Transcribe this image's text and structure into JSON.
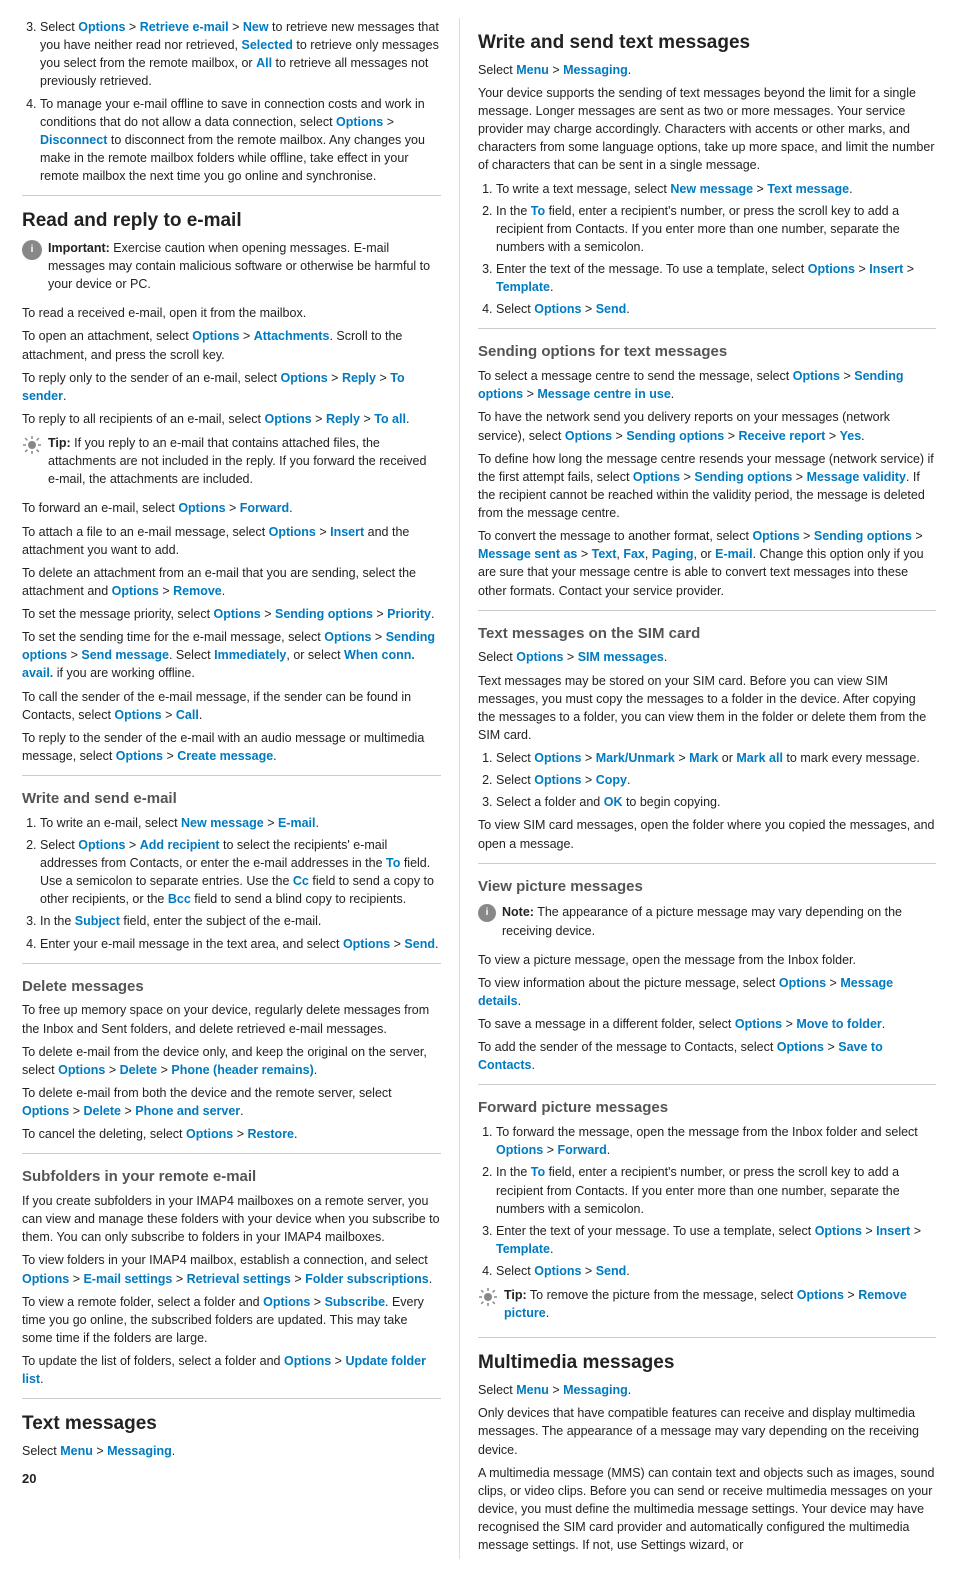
{
  "page_number": "20",
  "left": {
    "list_items_top": [
      {
        "num": "3.",
        "text": "Select ",
        "links": [
          {
            "label": "Options",
            "after": " > "
          },
          {
            "label": "Retrieve e-mail",
            "after": " > "
          },
          {
            "label": "New",
            "after": " to retrieve new messages that you have neither read nor retrieved, "
          },
          {
            "label": "Selected",
            "after": " to retrieve only messages you select from the remote mailbox, or "
          },
          {
            "label": "All",
            "after": " to retrieve all messages not previously retrieved."
          }
        ]
      },
      {
        "num": "4.",
        "text": "To manage your e-mail offline to save in connection costs and work in conditions that do not allow a data connection, select ",
        "links": [
          {
            "label": "Options",
            "after": " > "
          },
          {
            "label": "Disconnect",
            "after": " to disconnect from the remote mailbox. Any changes you make in the remote mailbox folders while offline, take effect in your remote mailbox the next time you go online and synchronise."
          }
        ]
      }
    ],
    "read_reply": {
      "heading": "Read and reply to e-mail",
      "important_label": "Important:",
      "important_text": " Exercise caution when opening messages. E-mail messages may contain malicious software or otherwise be harmful to your device or PC.",
      "para1": "To read a received e-mail, open it from the mailbox.",
      "para2_before": "To open an attachment, select ",
      "para2_link1": "Options",
      "para2_mid": " > ",
      "para2_link2": "Attachments",
      "para2_after": ". Scroll to the attachment, and press the scroll key.",
      "para3_before": "To reply only to the sender of an e-mail, select ",
      "para3_link1": "Options",
      "para3_mid": " > ",
      "para3_link2": "Reply",
      "para3_mid2": " > ",
      "para3_link3": "To sender",
      "para3_after": ".",
      "para4_before": "To reply to all recipients of an e-mail, select ",
      "para4_link1": "Options",
      "para4_mid": " > ",
      "para4_link2": "Reply",
      "para4_mid2": " > ",
      "para4_link3": "To all",
      "para4_after": ".",
      "tip1_label": "Tip:",
      "tip1_text": " If you reply to an e-mail that contains attached files, the attachments are not included in the reply. If you forward the received e-mail, the attachments are included.",
      "para5_before": "To forward an e-mail, select ",
      "para5_link1": "Options",
      "para5_mid": " > ",
      "para5_link2": "Forward",
      "para5_after": ".",
      "para6_before": "To attach a file to an e-mail message, select ",
      "para6_link1": "Options",
      "para6_mid": " > ",
      "para6_link2": "Insert",
      "para6_after": " and the attachment you want to add.",
      "para7": "To delete an attachment from an e-mail that you are sending, select the attachment and ",
      "para7_link1": "Options",
      "para7_mid": " > ",
      "para7_link2": "Remove",
      "para7_after": ".",
      "para8_before": "To set the message priority, select ",
      "para8_link1": "Options",
      "para8_mid": " > ",
      "para8_link2": "Sending options",
      "para8_mid2": " > ",
      "para8_link3": "Priority",
      "para8_after": ".",
      "para9_before": "To set the sending time for the e-mail message, select ",
      "para9_link1": "Options",
      "para9_mid": " > ",
      "para9_link2": "Sending options",
      "para9_mid2": " > ",
      "para9_link3": "Send message",
      "para9_after": ". Select ",
      "para9_link4": "Immediately",
      "para9_mid3": ", or select ",
      "para9_link5": "When conn. avail.",
      "para9_after2": " if you are working offline.",
      "para10_before": "To call the sender of the e-mail message, if the sender can be found in Contacts, select ",
      "para10_link1": "Options",
      "para10_mid": " > ",
      "para10_link2": "Call",
      "para10_after": ".",
      "para11_before": "To reply to the sender of the e-mail with an audio message or multimedia message, select ",
      "para11_link1": "Options",
      "para11_mid": " > ",
      "para11_link2": "Create message",
      "para11_after": "."
    },
    "write_send_email": {
      "heading": "Write and send e-mail",
      "items": [
        {
          "num": "1.",
          "before": "To write an e-mail, select ",
          "link1": "New message",
          "mid": " > ",
          "link2": "E-mail",
          "after": "."
        },
        {
          "num": "2.",
          "before": "Select ",
          "link1": "Options",
          "mid": " > ",
          "link2": "Add recipient",
          "after": " to select the recipients' e-mail addresses from Contacts, or enter the e-mail addresses in the ",
          "link3": "To",
          "after2": " field. Use a semicolon to separate entries. Use the ",
          "link4": "Cc",
          "after3": " field to send a copy to other recipients, or the ",
          "link5": "Bcc",
          "after4": " field to send a blind copy to recipients."
        },
        {
          "num": "3.",
          "before": "In the ",
          "link1": "Subject",
          "after": " field, enter the subject of the e-mail."
        },
        {
          "num": "4.",
          "before": "Enter your e-mail message in the text area, and select ",
          "link1": "Options",
          "mid": " > ",
          "link2": "Send",
          "after": "."
        }
      ]
    },
    "delete_messages": {
      "heading": "Delete messages",
      "para1": "To free up memory space on your device, regularly delete messages from the Inbox and Sent folders, and delete retrieved e-mail messages.",
      "para2_before": "To delete e-mail from the device only, and keep the original on the server, select ",
      "para2_link1": "Options",
      "para2_mid": " > ",
      "para2_link2": "Delete",
      "para2_mid2": " > ",
      "para2_link3": "Phone (header remains)",
      "para2_after": ".",
      "para3_before": "To delete e-mail from both the device and the remote server, select ",
      "para3_link1": "Options",
      "para3_mid": " > ",
      "para3_link2": "Delete",
      "para3_mid2": " > ",
      "para3_link3": "Phone and server",
      "para3_after": ".",
      "para4_before": "To cancel the deleting, select ",
      "para4_link1": "Options",
      "para4_mid": " > ",
      "para4_link2": "Restore",
      "para4_after": "."
    },
    "subfolders": {
      "heading": "Subfolders in your remote e-mail",
      "para1": "If you create subfolders in your IMAP4 mailboxes on a remote server, you can view and manage these folders with your device when you subscribe to them. You can only subscribe to folders in your IMAP4 mailboxes.",
      "para2_before": "To view folders in your IMAP4 mailbox, establish a connection, and select ",
      "para2_link1": "Options",
      "para2_mid": " > ",
      "para2_link2": "E-mail settings",
      "para2_mid2": " > ",
      "para2_link3": "Retrieval settings",
      "para2_mid3": " > ",
      "para2_link4": "Folder subscriptions",
      "para2_after": ".",
      "para3_before": "To view a remote folder, select a folder and ",
      "para3_link1": "Options",
      "para3_mid": " > ",
      "para3_link2": "Subscribe",
      "para3_after": ". Every time you go online, the subscribed folders are updated. This may take some time if the folders are large.",
      "para4_before": "To update the list of folders, select a folder and ",
      "para4_link1": "Options",
      "para4_mid": " > ",
      "para4_link2": "Update folder list",
      "para4_after": "."
    },
    "text_messages": {
      "heading": "Text messages",
      "select_before": "Select ",
      "select_link1": "Menu",
      "select_mid": " > ",
      "select_link2": "Messaging",
      "select_after": "."
    }
  },
  "right": {
    "write_send_text": {
      "heading": "Write and send text messages",
      "select_before": "Select ",
      "select_link1": "Menu",
      "select_mid": " > ",
      "select_link2": "Messaging",
      "select_after": ".",
      "para1": "Your device supports the sending of text messages beyond the limit for a single message. Longer messages are sent as two or more messages. Your service provider may charge accordingly. Characters with accents or other marks, and characters from some language options, take up more space, and limit the number of characters that can be sent in a single message.",
      "items": [
        {
          "num": "1.",
          "before": "To write a text message, select ",
          "link1": "New message",
          "mid": " > ",
          "link2": "Text message",
          "after": "."
        },
        {
          "num": "2.",
          "before": "In the ",
          "link1": "To",
          "after": " field, enter a recipient's number, or press the scroll key to add a recipient from Contacts. If you enter more than one number, separate the numbers with a semicolon."
        },
        {
          "num": "3.",
          "before": "Enter the text of the message. To use a template, select ",
          "link1": "Options",
          "mid": " > ",
          "link2": "Insert",
          "mid2": " > ",
          "link3": "Template",
          "after": "."
        },
        {
          "num": "4.",
          "before": "Select ",
          "link1": "Options",
          "mid": " > ",
          "link2": "Send",
          "after": "."
        }
      ]
    },
    "sending_options_text": {
      "heading": "Sending options for text messages",
      "para1_before": "To select a message centre to send the message, select ",
      "para1_link1": "Options",
      "para1_mid": " > ",
      "para1_link2": "Sending options",
      "para1_mid2": " > ",
      "para1_link3": "Message centre in use",
      "para1_after": ".",
      "para2_before": "To have the network send you delivery reports on your messages (network service), select ",
      "para2_link1": "Options",
      "para2_mid": " > ",
      "para2_link2": "Sending options",
      "para2_mid2": " > ",
      "para2_link3": "Receive report",
      "para2_mid3": " > ",
      "para2_link4": "Yes",
      "para2_after": ".",
      "para3_before": "To define how long the message centre resends your message (network service) if the first attempt fails, select ",
      "para3_link1": "Options",
      "para3_mid": " > ",
      "para3_link2": "Sending options",
      "para3_mid2": " > ",
      "para3_link3": "Message validity",
      "para3_after": ". If the recipient cannot be reached within the validity period, the message is deleted from the message centre.",
      "para4_before": "To convert the message to another format, select ",
      "para4_link1": "Options",
      "para4_mid": " > ",
      "para4_link2": "Sending options",
      "para4_mid2": " > ",
      "para4_link3": "Message sent as",
      "para4_mid3": " > ",
      "para4_link4": "Text",
      "para4_mid4": ", ",
      "para4_link5": "Fax",
      "para4_mid5": ", ",
      "para4_link6": "Paging",
      "para4_mid6": ", or ",
      "para4_link7": "E-mail",
      "para4_after": ". Change this option only if you are sure that your message centre is able to convert text messages into these other formats. Contact your service provider."
    },
    "text_sim": {
      "heading": "Text messages on the SIM card",
      "select_before": "Select ",
      "select_link1": "Options",
      "select_mid": " > ",
      "select_link2": "SIM messages",
      "select_after": ".",
      "para1": "Text messages may be stored on your SIM card. Before you can view SIM messages, you must copy the messages to a folder in the device. After copying the messages to a folder, you can view them in the folder or delete them from the SIM card.",
      "items": [
        {
          "num": "1.",
          "before": "Select ",
          "link1": "Options",
          "mid": " > ",
          "link2": "Mark/Unmark",
          "mid2": " > ",
          "link3": "Mark",
          "mid3": " or ",
          "link4": "Mark all",
          "after": " to mark every message."
        },
        {
          "num": "2.",
          "before": "Select ",
          "link1": "Options",
          "mid": " > ",
          "link2": "Copy",
          "after": "."
        },
        {
          "num": "3.",
          "before": "Select a folder and ",
          "link1": "OK",
          "after": " to begin copying."
        }
      ],
      "para2": "To view SIM card messages, open the folder where you copied the messages, and open a message."
    },
    "view_picture": {
      "heading": "View picture messages",
      "note_label": "Note:",
      "note_text": " The appearance of a picture message may vary depending on the receiving device.",
      "para1": "To view a picture message, open the message from the Inbox folder.",
      "para2_before": "To view information about the picture message, select ",
      "para2_link1": "Options",
      "para2_mid": " > ",
      "para2_link2": "Message details",
      "para2_after": ".",
      "para3_before": "To save a message in a different folder, select ",
      "para3_link1": "Options",
      "para3_mid": " > ",
      "para3_link2": "Move to folder",
      "para3_after": ".",
      "para4_before": "To add the sender of the message to Contacts, select ",
      "para4_link1": "Options",
      "para4_mid": " > ",
      "para4_link2": "Save to Contacts",
      "para4_after": "."
    },
    "forward_picture": {
      "heading": "Forward picture messages",
      "items": [
        {
          "num": "1.",
          "before": "To forward the message, open the message from the Inbox folder and select ",
          "link1": "Options",
          "mid": " > ",
          "link2": "Forward",
          "after": "."
        },
        {
          "num": "2.",
          "before": "In the ",
          "link1": "To",
          "after": " field, enter a recipient's number, or press the scroll key to add a recipient from Contacts. If you enter more than one number, separate the numbers with a semicolon."
        },
        {
          "num": "3.",
          "before": "Enter the text of your message. To use a template, select ",
          "link1": "Options",
          "mid": " > ",
          "link2": "Insert",
          "mid2": " > ",
          "link3": "Template",
          "after": "."
        },
        {
          "num": "4.",
          "before": "Select ",
          "link1": "Options",
          "mid": " > ",
          "link2": "Send",
          "after": "."
        }
      ],
      "tip_label": "Tip:",
      "tip_before": " To remove the picture from the message, select ",
      "tip_link1": "Options",
      "tip_mid": " > ",
      "tip_link2": "Remove picture",
      "tip_after": "."
    },
    "multimedia": {
      "heading": "Multimedia messages",
      "select_before": "Select ",
      "select_link1": "Menu",
      "select_mid": " > ",
      "select_link2": "Messaging",
      "select_after": ".",
      "para1": "Only devices that have compatible features can receive and display multimedia messages. The appearance of a message may vary depending on the receiving device.",
      "para2": "A multimedia message (MMS) can contain text and objects such as images, sound clips, or video clips. Before you can send or receive multimedia messages on your device, you must define the multimedia message settings. Your device may have recognised the SIM card provider and automatically configured the multimedia message settings. If not, use Settings wizard, or"
    }
  }
}
